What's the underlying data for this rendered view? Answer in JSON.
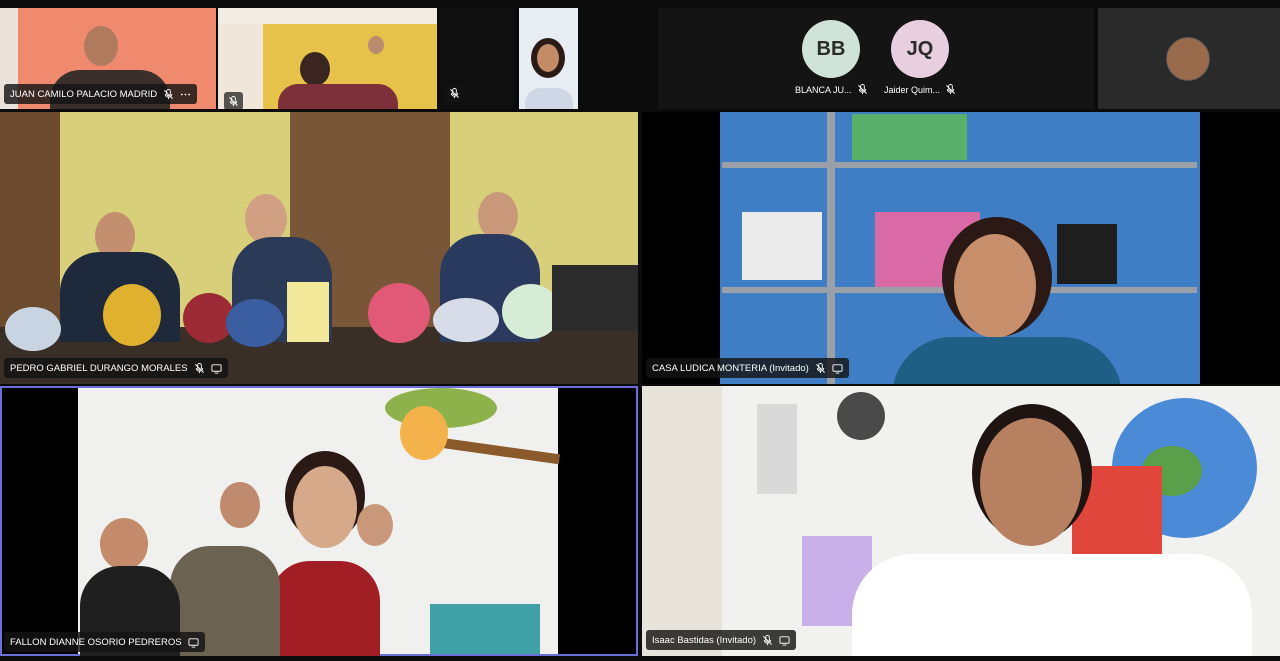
{
  "app": {
    "accent": "#6b6fd6",
    "tile_bg": "#161616",
    "page_bg": "#0b0b0b"
  },
  "top_strip": {
    "tiles": [
      {
        "name": "JUAN CAMILO PALACIO MADRID",
        "muted": true,
        "has_more": true
      },
      {
        "name": "",
        "muted": true
      },
      {
        "name": "",
        "muted": true
      },
      {
        "name": "",
        "muted": false
      }
    ],
    "avatars": [
      {
        "initials": "BB",
        "label": "BLANCA JU...",
        "color": "#cfe3d8",
        "muted": true
      },
      {
        "initials": "JQ",
        "label": "Jaider Quim...",
        "color": "#e7cfdf",
        "muted": true
      }
    ]
  },
  "grid": [
    {
      "name": "PEDRO GABRIEL DURANGO MORALES",
      "muted": true,
      "screen": true
    },
    {
      "name": "CASA LUDICA MONTERIA (Invitado)",
      "muted": true,
      "screen": true
    },
    {
      "name": "FALLON DIANNE OSORIO PEDREROS",
      "muted": false,
      "screen": true,
      "active": true
    },
    {
      "name": "Isaac Bastidas (Invitado)",
      "muted": true,
      "screen": true
    }
  ],
  "icons": {
    "mic_off": "mic-off-icon",
    "screen": "screen-share-icon",
    "more": "more-options-icon"
  }
}
